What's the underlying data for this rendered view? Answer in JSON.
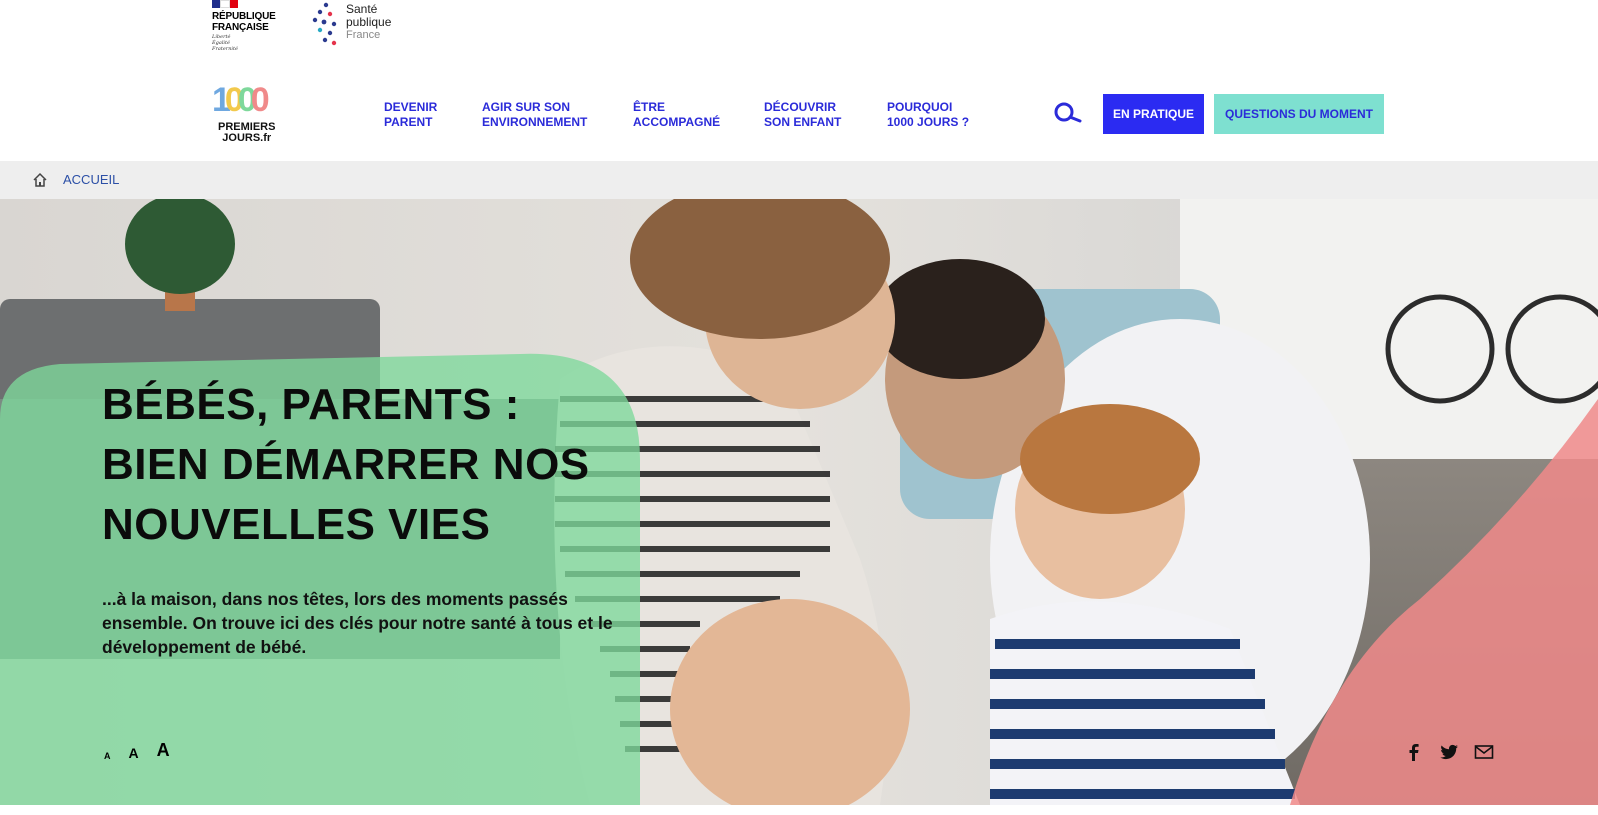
{
  "brand": {
    "republique": "RÉPUBLIQUE\nFRANÇAISE",
    "motto": "Liberté\nÉgalité\nFraternité",
    "spf_line1": "Santé",
    "spf_line2": "publique",
    "spf_line3": "France",
    "logo_digits": "1000",
    "logo_words": "PREMIERS\nJOURS.fr"
  },
  "nav": {
    "items": [
      {
        "label": "DEVENIR\nPARENT"
      },
      {
        "label": "AGIR SUR SON\nENVIRONNEMENT"
      },
      {
        "label": "ÊTRE\nACCOMPAGNÉ"
      },
      {
        "label": "DÉCOUVRIR\nSON ENFANT"
      },
      {
        "label": "POURQUOI\n1000 JOURS ?"
      }
    ],
    "search_icon": "search-icon",
    "btn_pratique": "EN PRATIQUE",
    "btn_moment": "QUESTIONS DU MOMENT"
  },
  "breadcrumb": {
    "home_icon": "home-icon",
    "current": "ACCUEIL"
  },
  "hero": {
    "title": "BÉBÉS, PARENTS :\nBIEN DÉMARRER NOS\nNOUVELLES VIES",
    "subtitle": "...à la maison, dans nos têtes, lors des moments passés ensemble. On trouve ici des clés pour notre santé à tous et le développement de bébé.",
    "font_size_labels": [
      "A",
      "A",
      "A"
    ],
    "share_icons": [
      "facebook-icon",
      "twitter-icon",
      "email-icon"
    ]
  },
  "colors": {
    "primary_blue": "#2b2bf2",
    "turquoise": "#7ee0d0",
    "hero_green": "#7ed89b",
    "hero_pink": "#f08a8a"
  }
}
